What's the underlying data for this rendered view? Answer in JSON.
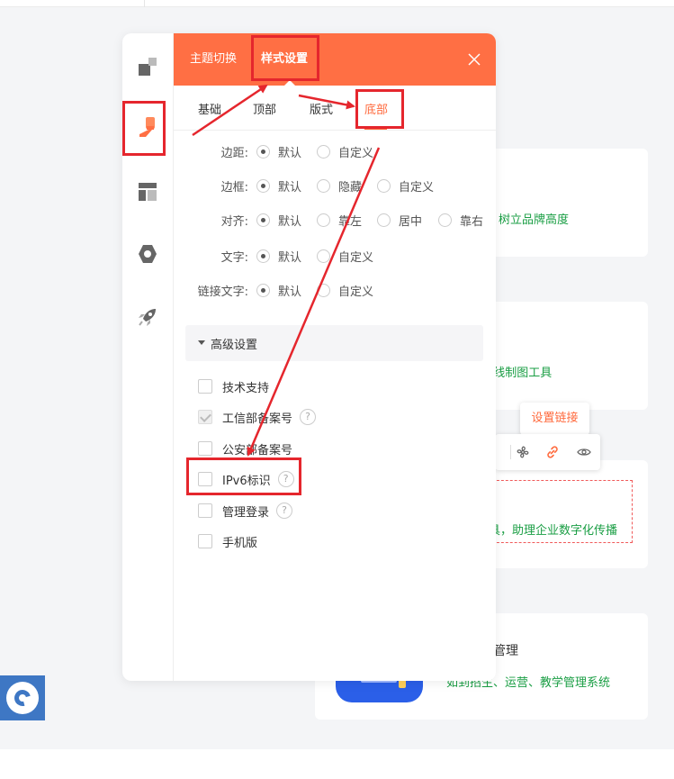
{
  "background": {
    "card1_text": "树立品牌高度",
    "card2_text": "E线制图工具",
    "card3_text": "具，助理企业数字化传播",
    "card4_title": "管理",
    "card4_text": "如到招生、运营、教学管理系统"
  },
  "tooltip": {
    "text": "设置链接"
  },
  "mini_toolbar": {
    "icons": [
      "fan-icon",
      "link-icon",
      "eye-icon"
    ]
  },
  "rail": {
    "icons": [
      "layers-icon",
      "brush-icon",
      "layout-icon",
      "hexagon-icon",
      "rocket-icon"
    ]
  },
  "header": {
    "tabs": [
      "主题切换",
      "样式设置"
    ],
    "active_tab": "样式设置"
  },
  "subtabs": {
    "items": [
      "基础",
      "顶部",
      "版式",
      "底部"
    ],
    "active": "底部"
  },
  "settings": {
    "margin": {
      "label": "边距:",
      "options": [
        "默认",
        "自定义"
      ],
      "selected": "默认"
    },
    "border": {
      "label": "边框:",
      "options": [
        "默认",
        "隐藏",
        "自定义"
      ],
      "selected": "默认"
    },
    "align": {
      "label": "对齐:",
      "options": [
        "默认",
        "靠左",
        "居中",
        "靠右"
      ],
      "selected": "默认"
    },
    "text": {
      "label": "文字:",
      "options": [
        "默认",
        "自定义"
      ],
      "selected": "默认"
    },
    "link_text": {
      "label": "链接文字:",
      "options": [
        "默认",
        "自定义"
      ],
      "selected": "默认"
    }
  },
  "advanced": {
    "title": "高级设置",
    "items": [
      {
        "label": "技术支持",
        "checked": false,
        "help": false
      },
      {
        "label": "工信部备案号",
        "checked": true,
        "help": true
      },
      {
        "label": "公安部备案号",
        "checked": false,
        "help": false
      },
      {
        "label": "IPv6标识",
        "checked": false,
        "help": true
      },
      {
        "label": "管理登录",
        "checked": false,
        "help": true
      },
      {
        "label": "手机版",
        "checked": false,
        "help": false
      }
    ],
    "help_symbol": "?"
  },
  "colors": {
    "accent": "#ff6f44",
    "annotation": "#e5262d",
    "green_text": "#1a9e44"
  }
}
